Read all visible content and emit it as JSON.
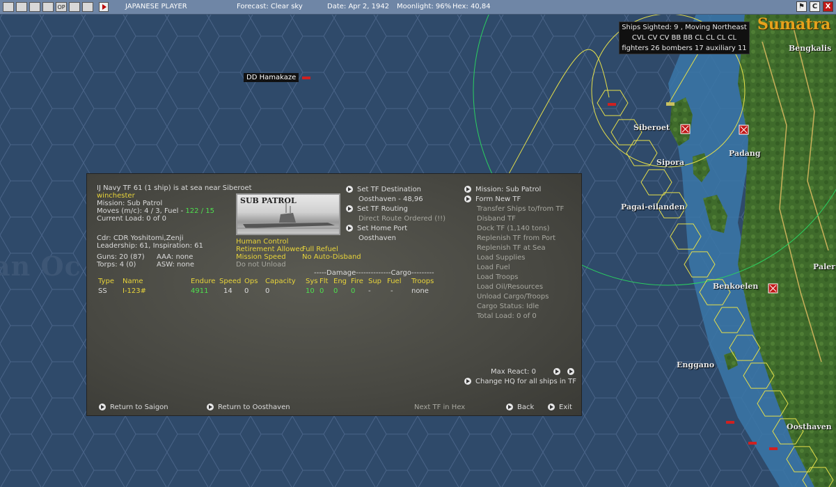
{
  "topbar": {
    "icons": [
      "tb-1",
      "tb-2",
      "tb-3",
      "tb-4",
      "OP",
      "tb-6",
      "tb-7"
    ],
    "player": "JAPANESE PLAYER",
    "forecast": "Forecast: Clear sky",
    "date": "Date: Apr 2, 1942",
    "moonlight": "Moonlight: 96%",
    "hex": "Hex: 40,84",
    "right_buttons": [
      "C",
      "X"
    ]
  },
  "map": {
    "region_label": "Sumatra",
    "places": [
      "Bengkalis",
      "Siberoet",
      "Padang",
      "Sipora",
      "Pagai-eilanden",
      "Benkoelen",
      "Enggano",
      "Oosthaven",
      "Paler"
    ],
    "ocean_label": "an Oc",
    "unit_tag": "DD Hamakaze",
    "sighting": {
      "line1": "Ships Sighted: 9 , Moving Northeast",
      "line2": "CVL CV CV BB BB CL CL CL CL",
      "line3": "fighters 26  bombers 17  auxiliary 11"
    },
    "colors": {
      "sea": "#2f4a6a",
      "land": "#3d6a2a",
      "hex_path": "#e6e04a",
      "range_ring": "#2ad060"
    }
  },
  "panel": {
    "title": "IJ Navy TF 61 (1 ship) is at sea near Siberoet",
    "commander_tag": "winchester",
    "mission": "Mission: Sub Patrol",
    "moves": "Moves (m/c): 4 / 3, Fuel - ",
    "fuel": "122 / 15",
    "current_load": "Current Load:  0 of 0",
    "cdr": "Cdr: CDR  Yoshitomi,Zenji",
    "leadership": "Leadership: 61, Inspiration: 61",
    "guns": "Guns: 20 (87)",
    "torps": "Torps: 4 (0)",
    "aaa": "AAA: none",
    "asw": "ASW: none",
    "photo_caption": "SUB PATROL",
    "human_control": "Human Control",
    "retirement": "Retirement Allowed",
    "full_refuel": "Full Refuel",
    "mission_speed": "Mission Speed",
    "no_auto_disband": "No Auto-Disband",
    "do_not_unload": "Do not Unload",
    "set_destination": "Set TF Destination",
    "destination_value": "Oosthaven - 48,96",
    "set_routing": "Set TF Routing",
    "direct_route": "Direct Route Ordered (!!)",
    "set_home_port": "Set Home Port",
    "home_port_value": "Oosthaven",
    "right_menu": {
      "mission_sub": "Mission: Sub Patrol",
      "form_new_tf": "Form New TF",
      "items": [
        "Transfer Ships to/from TF",
        "Disband TF",
        "Dock TF (1,140 tons)",
        "Replenish TF from Port",
        "Replenish TF at Sea",
        "Load Supplies",
        "Load Fuel",
        "Load Troops",
        "Load Oil/Resources",
        "Unload Cargo/Troops",
        "Cargo Status: Idle",
        "Total Load: 0 of 0"
      ]
    },
    "damage_header": "-----Damage-----",
    "cargo_header": "---------Cargo---------",
    "columns": [
      "Type",
      "Name",
      "Endure",
      "Speed",
      "Ops",
      "Capacity",
      "Sys",
      "Flt",
      "Eng",
      "Fire",
      "Sup",
      "Fuel",
      "Troops"
    ],
    "ship_row": {
      "type": "SS",
      "name": "I-123#",
      "endure": "4911",
      "speed": "14",
      "ops": "0",
      "capacity": "0",
      "sys": "10",
      "flt": "0",
      "eng": "0",
      "fire": "0",
      "sup": "-",
      "fuel": "-",
      "troops": "none"
    },
    "max_react": "Max React:  0",
    "change_hq": "Change HQ for all ships in TF",
    "return_saigon": "Return to Saigon",
    "return_oosthaven": "Return to Oosthaven",
    "next_tf": "Next TF in Hex",
    "back": "Back",
    "exit": "Exit"
  }
}
